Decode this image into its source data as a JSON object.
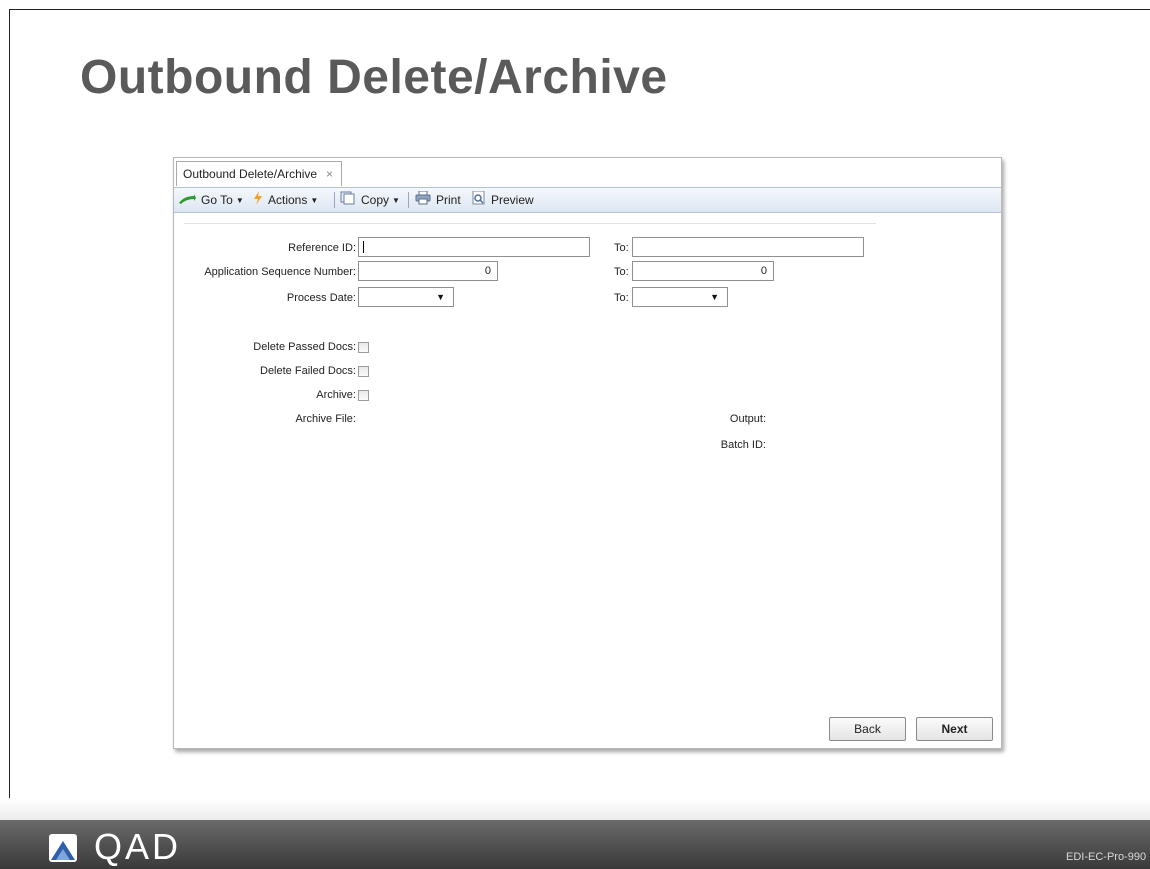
{
  "slide": {
    "title": "Outbound Delete/Archive",
    "footer_brand": "QAD",
    "footer_code": "EDI-EC-Pro-990"
  },
  "window": {
    "tab_title": "Outbound Delete/Archive",
    "tab_close": "×",
    "toolbar": {
      "goto_label": "Go To",
      "actions_label": "Actions",
      "copy_label": "Copy",
      "print_label": "Print",
      "preview_label": "Preview",
      "caret": "▼"
    }
  },
  "form": {
    "reference_id_label": "Reference ID:",
    "reference_id_value": "",
    "reference_id_to_label": "To:",
    "reference_id_to_value": "",
    "app_seq_label": "Application Sequence Number:",
    "app_seq_value": "0",
    "app_seq_to_label": "To:",
    "app_seq_to_value": "0",
    "process_date_label": "Process Date:",
    "process_date_value": "",
    "process_date_to_label": "To:",
    "process_date_to_value": "",
    "dropdown_arrow": "▼",
    "delete_passed_label": "Delete Passed Docs:",
    "delete_passed_checked": false,
    "delete_failed_label": "Delete Failed Docs:",
    "delete_failed_checked": false,
    "archive_label": "Archive:",
    "archive_checked": false,
    "archive_file_label": "Archive File:",
    "output_label": "Output:",
    "batch_id_label": "Batch ID:"
  },
  "buttons": {
    "back_label": "Back",
    "next_label": "Next"
  }
}
